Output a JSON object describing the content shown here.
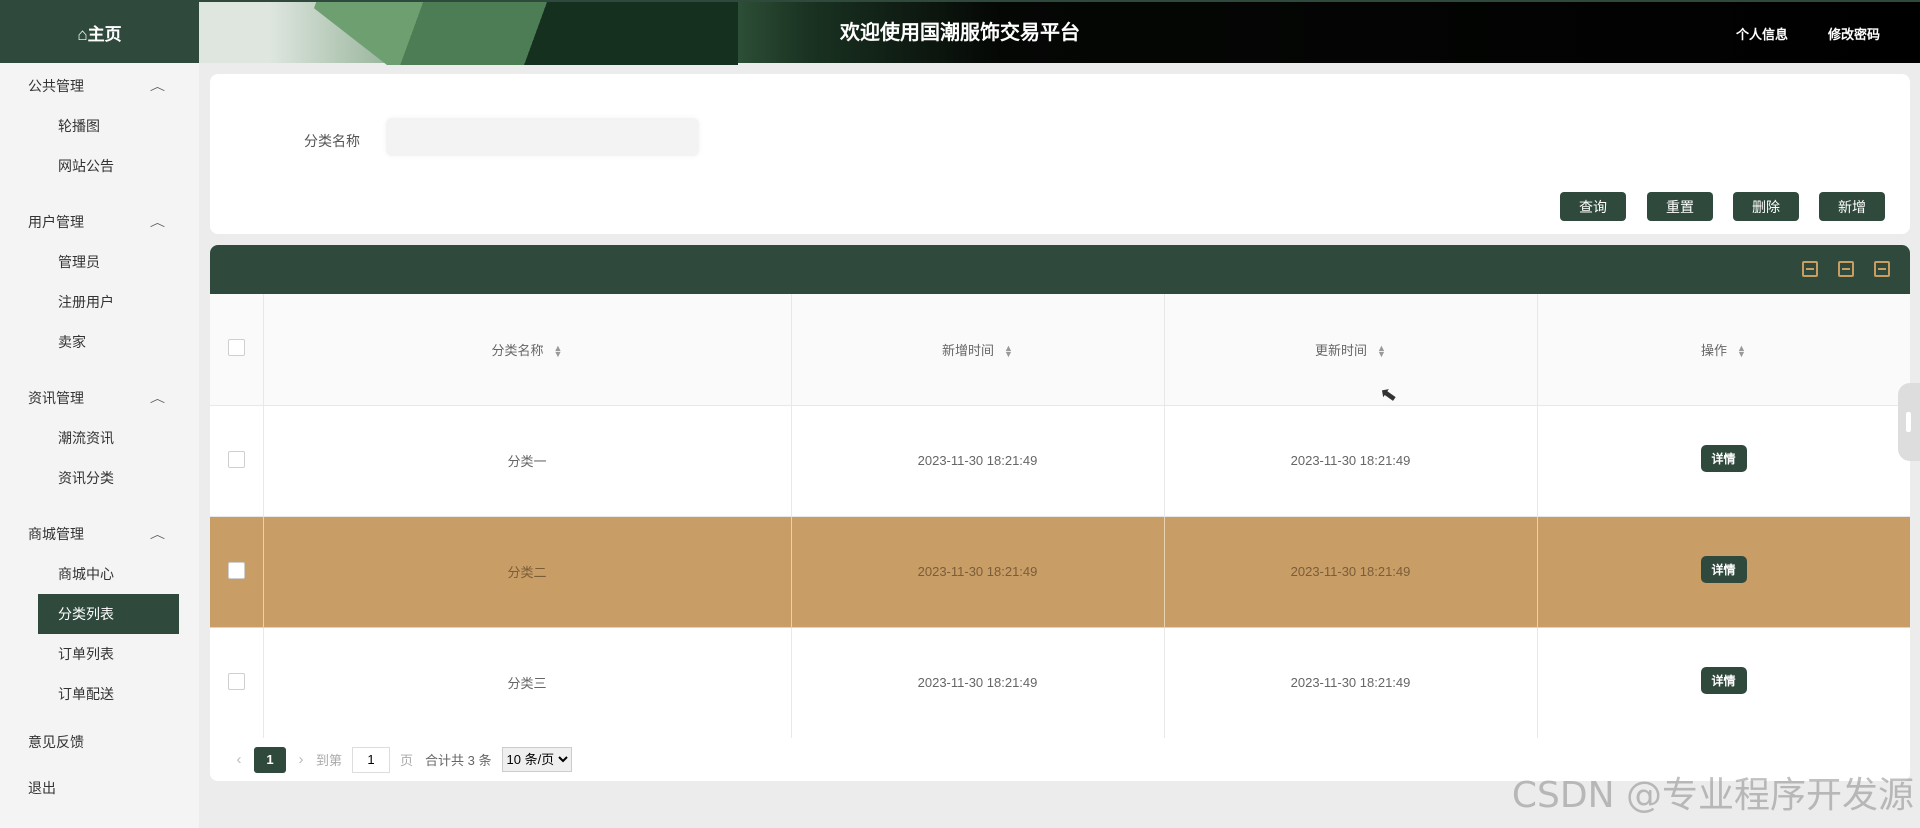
{
  "header": {
    "home_label": "⌂主页",
    "site_title": "欢迎使用国潮服饰交易平台",
    "profile_label": "个人信息",
    "change_password_label": "修改密码"
  },
  "sidebar": {
    "groups": [
      {
        "title": "公共管理",
        "items": [
          "轮播图",
          "网站公告"
        ]
      },
      {
        "title": "用户管理",
        "items": [
          "管理员",
          "注册用户",
          "卖家"
        ]
      },
      {
        "title": "资讯管理",
        "items": [
          "潮流资讯",
          "资讯分类"
        ]
      },
      {
        "title": "商城管理",
        "items": [
          "商城中心",
          "分类列表",
          "订单列表",
          "订单配送"
        ]
      }
    ],
    "feedback": "意见反馈",
    "logout": "退出",
    "active_item": "分类列表"
  },
  "search": {
    "label": "分类名称",
    "value": "",
    "buttons": {
      "query": "查询",
      "reset": "重置",
      "delete": "删除",
      "add": "新增"
    }
  },
  "table": {
    "columns": [
      "分类名称",
      "新增时间",
      "更新时间",
      "操作"
    ],
    "rows": [
      {
        "name": "分类一",
        "created": "2023-11-30 18:21:49",
        "updated": "2023-11-30 18:21:49",
        "action": "详情"
      },
      {
        "name": "分类二",
        "created": "2023-11-30 18:21:49",
        "updated": "2023-11-30 18:21:49",
        "action": "详情"
      },
      {
        "name": "分类三",
        "created": "2023-11-30 18:21:49",
        "updated": "2023-11-30 18:21:49",
        "action": "详情"
      }
    ],
    "highlight_row": 1
  },
  "pager": {
    "current_page": "1",
    "goto_label": "到第",
    "goto_value": "1",
    "page_unit": "页",
    "total_text": "合计共 3 条",
    "page_size": "10 条/页"
  },
  "watermark": "CSDN @专业程序开发源",
  "colors": {
    "primary": "#2f4a3d",
    "highlight": "#c89d66",
    "icon_accent": "#c89d61"
  }
}
